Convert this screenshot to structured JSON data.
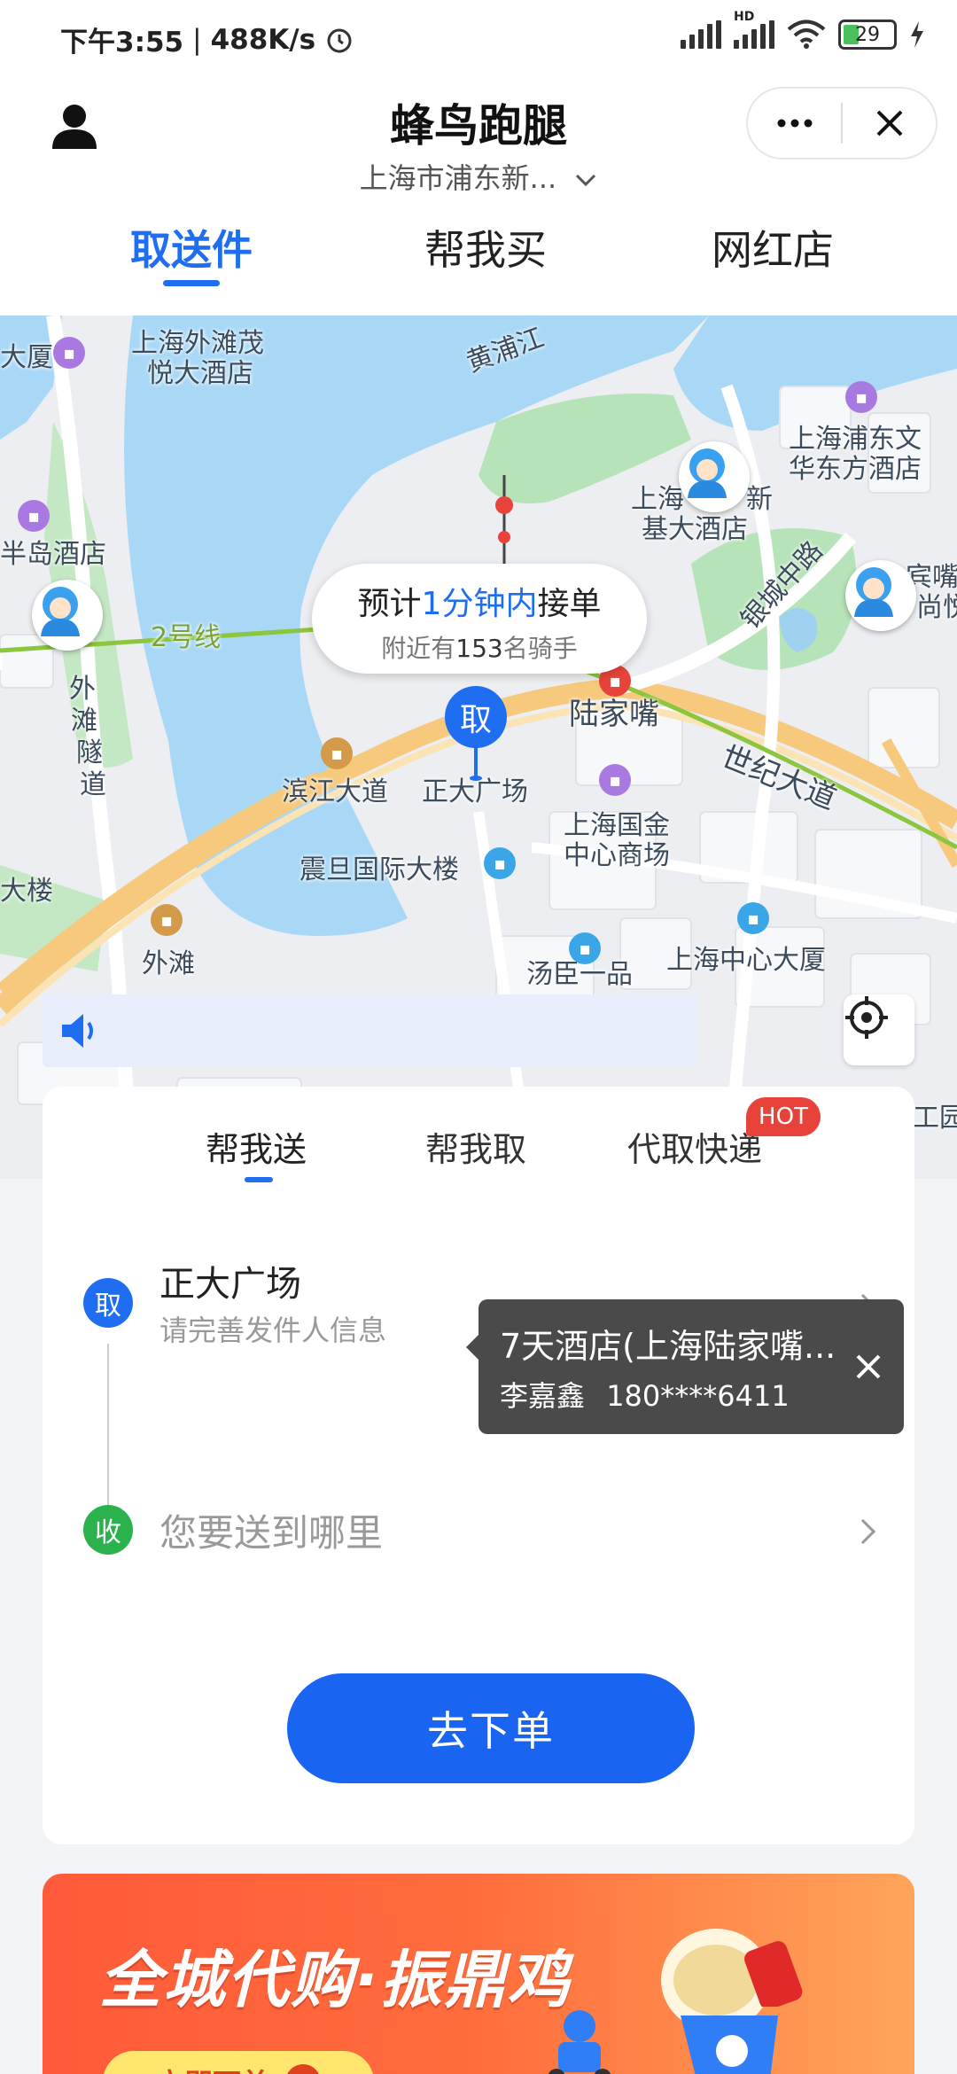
{
  "status_bar": {
    "time": "下午3:55",
    "speed": "488K/s",
    "network": "HD",
    "battery": "29"
  },
  "header": {
    "title": "蜂鸟跑腿",
    "location": "上海市浦东新...",
    "tabs": [
      {
        "label": "取送件",
        "active": true
      },
      {
        "label": "帮我买",
        "active": false
      },
      {
        "label": "网红店",
        "active": false
      }
    ]
  },
  "map": {
    "estimate_prefix": "预计",
    "estimate_value": "1分钟内",
    "estimate_suffix": "接单",
    "nearby_prefix": "附近有",
    "nearby_count": "153",
    "nearby_suffix": "名骑手",
    "pin_label": "取",
    "labels": [
      "上海外滩茂",
      "悦大酒店",
      "大厦",
      "黄浦江",
      "上海浦东文",
      "华东方酒店",
      "上海",
      "新",
      "基大酒店",
      "半岛酒店",
      "宾嘴",
      "尚悦",
      "2号线",
      "外",
      "滩",
      "隧",
      "道",
      "银城中路",
      "陆家嘴",
      "世纪大道",
      "滨江大道",
      "正大广场",
      "上海国金",
      "中心商场",
      "震旦国际大楼",
      "大楼",
      "外滩",
      "汤臣一品",
      "上海中心大厦",
      "工园"
    ]
  },
  "order_card": {
    "tabs": [
      {
        "label": "帮我送",
        "active": true
      },
      {
        "label": "帮我取",
        "active": false
      },
      {
        "label": "代取快递",
        "active": false
      }
    ],
    "hot_badge": "HOT",
    "pickup_marker": "取",
    "pickup_name": "正大广场",
    "pickup_hint": "请完善发件人信息",
    "dropoff_marker": "收",
    "dropoff_placeholder": "您要送到哪里",
    "contact_suggestion": {
      "name": "7天酒店(上海陆家嘴...",
      "person": "李嘉鑫",
      "phone": "180****6411"
    },
    "submit_label": "去下单"
  },
  "banner": {
    "title": "全城代购·振鼎鸡",
    "button_label": "立即下单"
  },
  "colors": {
    "accent": "#1f6ef2",
    "pickup": "#1f6ef2",
    "dropoff": "#2bb24c",
    "hot": "#e8433a",
    "banner": "#ff5a3a"
  }
}
